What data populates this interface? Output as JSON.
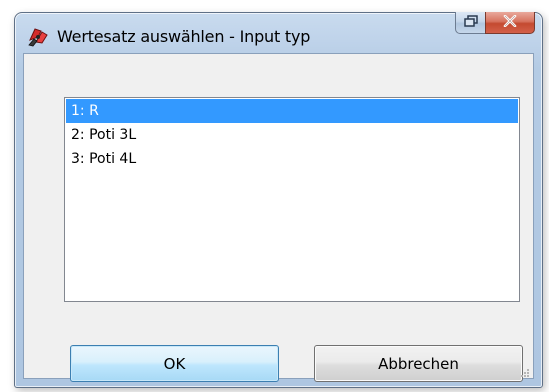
{
  "window": {
    "title": "Wertesatz auswählen - Input typ"
  },
  "titlebar": {
    "app_icon": "app-icon",
    "restore_icon": "restore-icon",
    "close_icon": "close-icon",
    "close_label": "x"
  },
  "list": {
    "items": [
      {
        "label": "1: R",
        "selected": true
      },
      {
        "label": "2: Poti 3L",
        "selected": false
      },
      {
        "label": "3: Poti 4L",
        "selected": false
      }
    ]
  },
  "buttons": {
    "ok_label": "OK",
    "cancel_label": "Abbrechen"
  },
  "colors": {
    "selection": "#3399ff",
    "close_button": "#c44a30",
    "frame": "#bfd3ea",
    "client_bg": "#f0f0f0"
  }
}
